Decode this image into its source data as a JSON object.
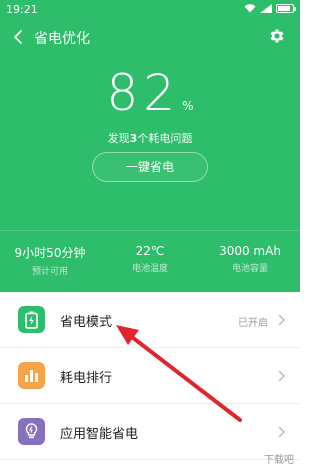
{
  "status": {
    "time": "19:21"
  },
  "nav": {
    "title": "省电优化",
    "back_icon": "back-arrow-icon",
    "settings_icon": "gear-icon"
  },
  "summary": {
    "percent": "82",
    "percent_sign": "%",
    "problem_prefix": "发现",
    "problem_count": "3",
    "problem_suffix": "个耗电问题",
    "optimize_label": "一键省电"
  },
  "stats": [
    {
      "value": "9小时50分钟",
      "label": "预计可用"
    },
    {
      "value": "22℃",
      "label": "电池温度"
    },
    {
      "value": "3000 mAh",
      "label": "电池容量"
    }
  ],
  "list": [
    {
      "label": "省电模式",
      "status": "已开启",
      "icon": "battery-mode-icon",
      "color": "#2ebd6b"
    },
    {
      "label": "耗电排行",
      "status": "",
      "icon": "bar-chart-icon",
      "color": "#f7a448"
    },
    {
      "label": "应用智能省电",
      "status": "",
      "icon": "bulb-icon",
      "color": "#8a6fbe"
    }
  ],
  "watermark": "下载吧",
  "colors": {
    "header": "#2ebd6b",
    "arrow": "#e0262c"
  }
}
